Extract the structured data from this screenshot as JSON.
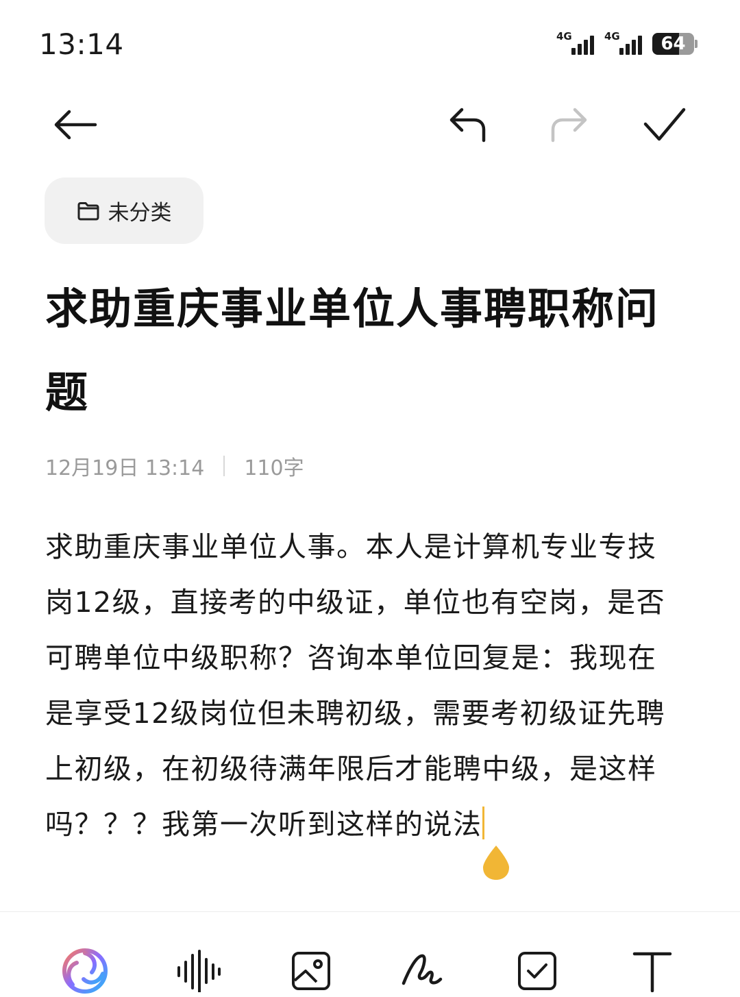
{
  "status_bar": {
    "time": "13:14",
    "network_1": "4G",
    "network_2": "4G",
    "battery_level": "64"
  },
  "toolbar": {
    "back_icon": "arrow-left-icon",
    "undo_icon": "undo-icon",
    "redo_icon": "redo-icon",
    "done_icon": "checkmark-icon",
    "redo_enabled": false
  },
  "note": {
    "category": "未分类",
    "category_icon": "folder-icon",
    "title": "求助重庆事业单位人事聘职称问题",
    "date": "12月19日 13:14",
    "word_count": "110字",
    "body": "求助重庆事业单位人事。本人是计算机专业专技岗12级，直接考的中级证，单位也有空岗，是否可聘单位中级职称？咨询本单位回复是：我现在是享受12级岗位但未聘初级，需要考初级证先聘上初级，在初级待满年限后才能聘中级，是这样吗？？？我第一次听到这样的说法"
  },
  "bottom_toolbar": {
    "items": [
      {
        "icon": "ai-assistant-icon"
      },
      {
        "icon": "voice-wave-icon"
      },
      {
        "icon": "image-icon"
      },
      {
        "icon": "handwriting-icon"
      },
      {
        "icon": "checklist-icon"
      },
      {
        "icon": "text-format-icon"
      }
    ]
  },
  "colors": {
    "accent": "#f1b635",
    "chip_bg": "#f1f1f1",
    "meta_text": "#9a9a9a"
  }
}
